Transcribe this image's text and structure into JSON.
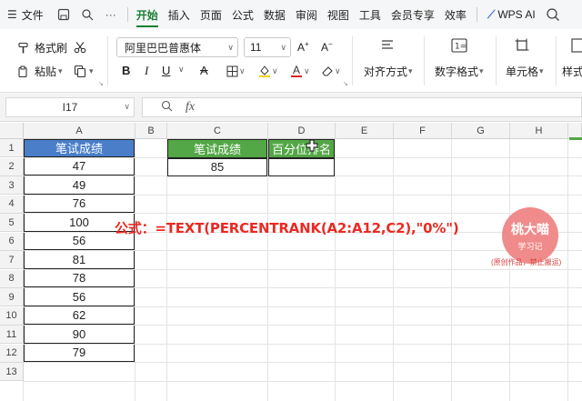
{
  "menubar": {
    "file_label": "文件",
    "tabs": [
      "开始",
      "插入",
      "页面",
      "公式",
      "数据",
      "审阅",
      "视图",
      "工具",
      "会员专享",
      "效率"
    ],
    "active_tab": "开始",
    "wps_ai_label": "WPS AI"
  },
  "ribbon": {
    "format_painter_label": "格式刷",
    "paste_label": "粘贴",
    "font_name": "阿里巴巴普惠体",
    "font_size": "11",
    "align_label": "对齐方式",
    "number_format_label": "数字格式",
    "cell_label": "单元格",
    "style_label": "样式"
  },
  "formula_bar": {
    "name_box": "I17",
    "fx_label": "fx",
    "formula": ""
  },
  "sheet": {
    "columns": [
      "A",
      "B",
      "C",
      "D",
      "E",
      "F",
      "G",
      "H"
    ],
    "rows": [
      "1",
      "2",
      "3",
      "4",
      "5",
      "6",
      "7",
      "8",
      "9",
      "10",
      "11",
      "12",
      "13"
    ],
    "a_header": "笔试成绩",
    "a_values": [
      "47",
      "49",
      "76",
      "100",
      "56",
      "81",
      "78",
      "56",
      "62",
      "90",
      "79"
    ],
    "c_header": "笔试成绩",
    "d_header": "百分位排名",
    "c_value": "85",
    "d_value": ""
  },
  "overlay": {
    "formula_note": "公式：=TEXT(PERCENTRANK(A2:A12,C2),\"0%\")",
    "watermark_title": "桃大喵",
    "watermark_sub": "学习记",
    "watermark_caption": "(原创作品，禁止搬运)"
  },
  "colors": {
    "active_tab": "#1a7f37",
    "header_blue": "#4a7ec9",
    "header_green": "#53a746",
    "note_red": "#ea2a22",
    "watermark": "#f08b8b"
  }
}
